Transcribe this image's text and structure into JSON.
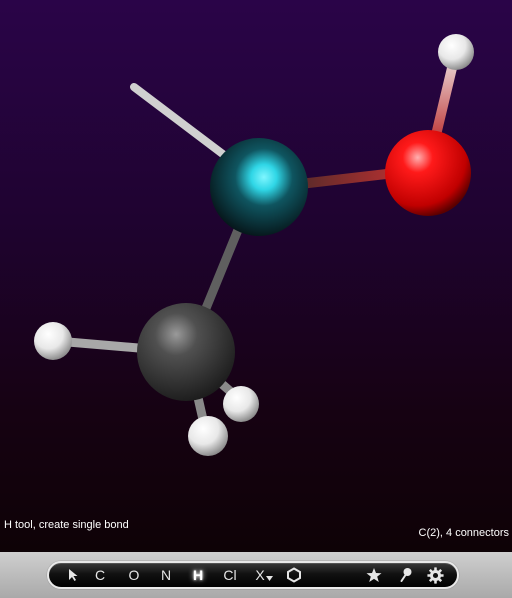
{
  "status": {
    "left": "H tool, create single bond",
    "right": "C(2), 4 connectors"
  },
  "toolbar": {
    "tools": [
      {
        "id": "select",
        "icon": "arrow-cursor-icon",
        "label": ""
      },
      {
        "id": "carbon",
        "label": "C"
      },
      {
        "id": "oxygen",
        "label": "O"
      },
      {
        "id": "nitrogen",
        "label": "N"
      },
      {
        "id": "hydrogen",
        "label": "H",
        "active": true
      },
      {
        "id": "chlorine",
        "label": "Cl"
      },
      {
        "id": "other-element",
        "label": "X",
        "icon": "dropdown-triangle-icon"
      },
      {
        "id": "ring",
        "icon": "hexagon-icon",
        "label": ""
      },
      {
        "id": "favorites",
        "icon": "star-icon",
        "label": ""
      },
      {
        "id": "pin",
        "icon": "pin-icon",
        "label": ""
      },
      {
        "id": "settings",
        "icon": "gear-icon",
        "label": ""
      }
    ]
  },
  "molecule": {
    "atoms": [
      {
        "id": "C2",
        "element": "C",
        "color": "#0d2e36",
        "highlight": "#2fd6e6",
        "selected": true
      },
      {
        "id": "O",
        "element": "O",
        "color": "#ff0000"
      },
      {
        "id": "H-O",
        "element": "H",
        "color": "#ffffff"
      },
      {
        "id": "C1",
        "element": "C",
        "color": "#4a4a4a"
      },
      {
        "id": "H-a",
        "element": "H",
        "color": "#ffffff"
      },
      {
        "id": "H-b",
        "element": "H",
        "color": "#ffffff"
      },
      {
        "id": "H-c",
        "element": "H",
        "color": "#ffffff"
      }
    ],
    "colors": {
      "oxygen": "#ff0000",
      "carbon": "#4a4a4a",
      "hydrogen": "#ffffff",
      "selection": "#2fd6e6"
    }
  }
}
